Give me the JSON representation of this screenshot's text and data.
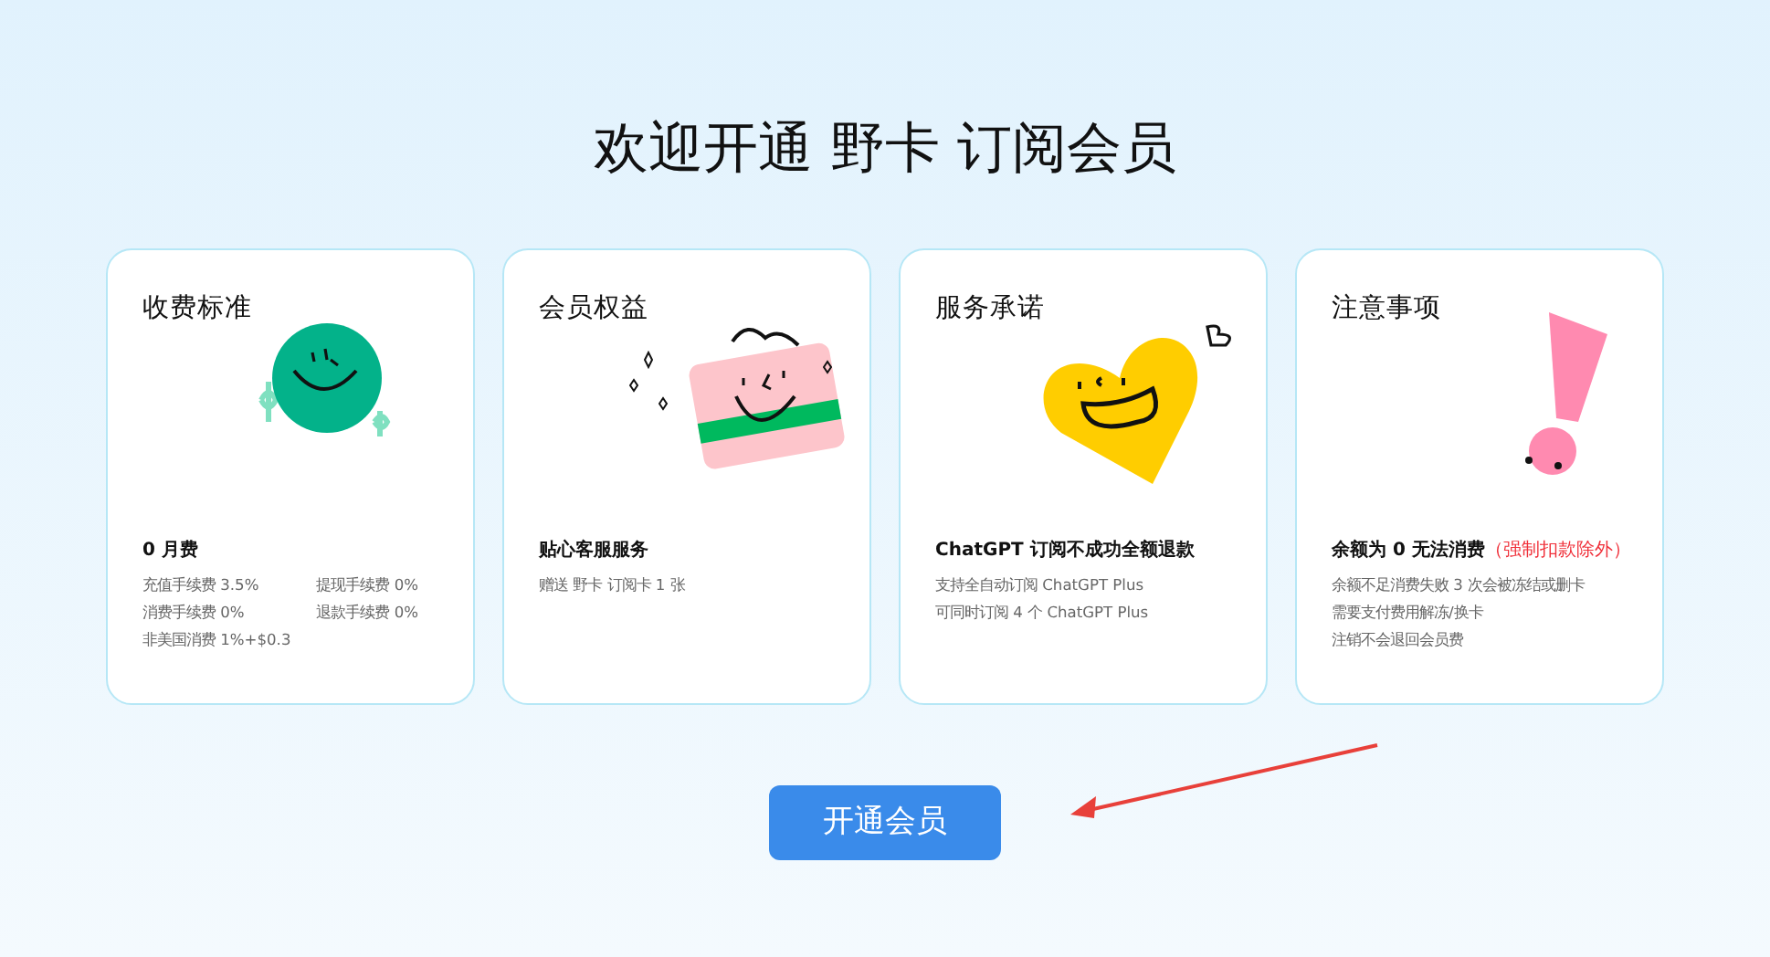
{
  "heading": "欢迎开通 野卡 订阅会员",
  "cards": [
    {
      "title": "收费标准",
      "kind": "coin",
      "headline": "0 月费",
      "details": [
        "充值手续费 3.5%",
        "提现手续费 0%",
        "消费手续费 0%",
        "退款手续费 0%",
        "非美国消费 1%+$0.3"
      ]
    },
    {
      "title": "会员权益",
      "kind": "card",
      "headline": "贴心客服服务",
      "details": [
        "赠送 野卡 订阅卡 1 张"
      ]
    },
    {
      "title": "服务承诺",
      "kind": "heart",
      "headline": "ChatGPT 订阅不成功全额退款",
      "details": [
        "支持全自动订阅 ChatGPT Plus",
        "可同时订阅 4 个 ChatGPT Plus"
      ]
    },
    {
      "title": "注意事项",
      "kind": "alert",
      "headline": "余额为 0 无法消费",
      "note": "（强制扣款除外）",
      "details": [
        "余额不足消费失败 3 次会被冻结或删卡",
        "需要支付费用解冻/换卡",
        "注销不会退回会员费"
      ]
    }
  ],
  "button": "开通会员"
}
